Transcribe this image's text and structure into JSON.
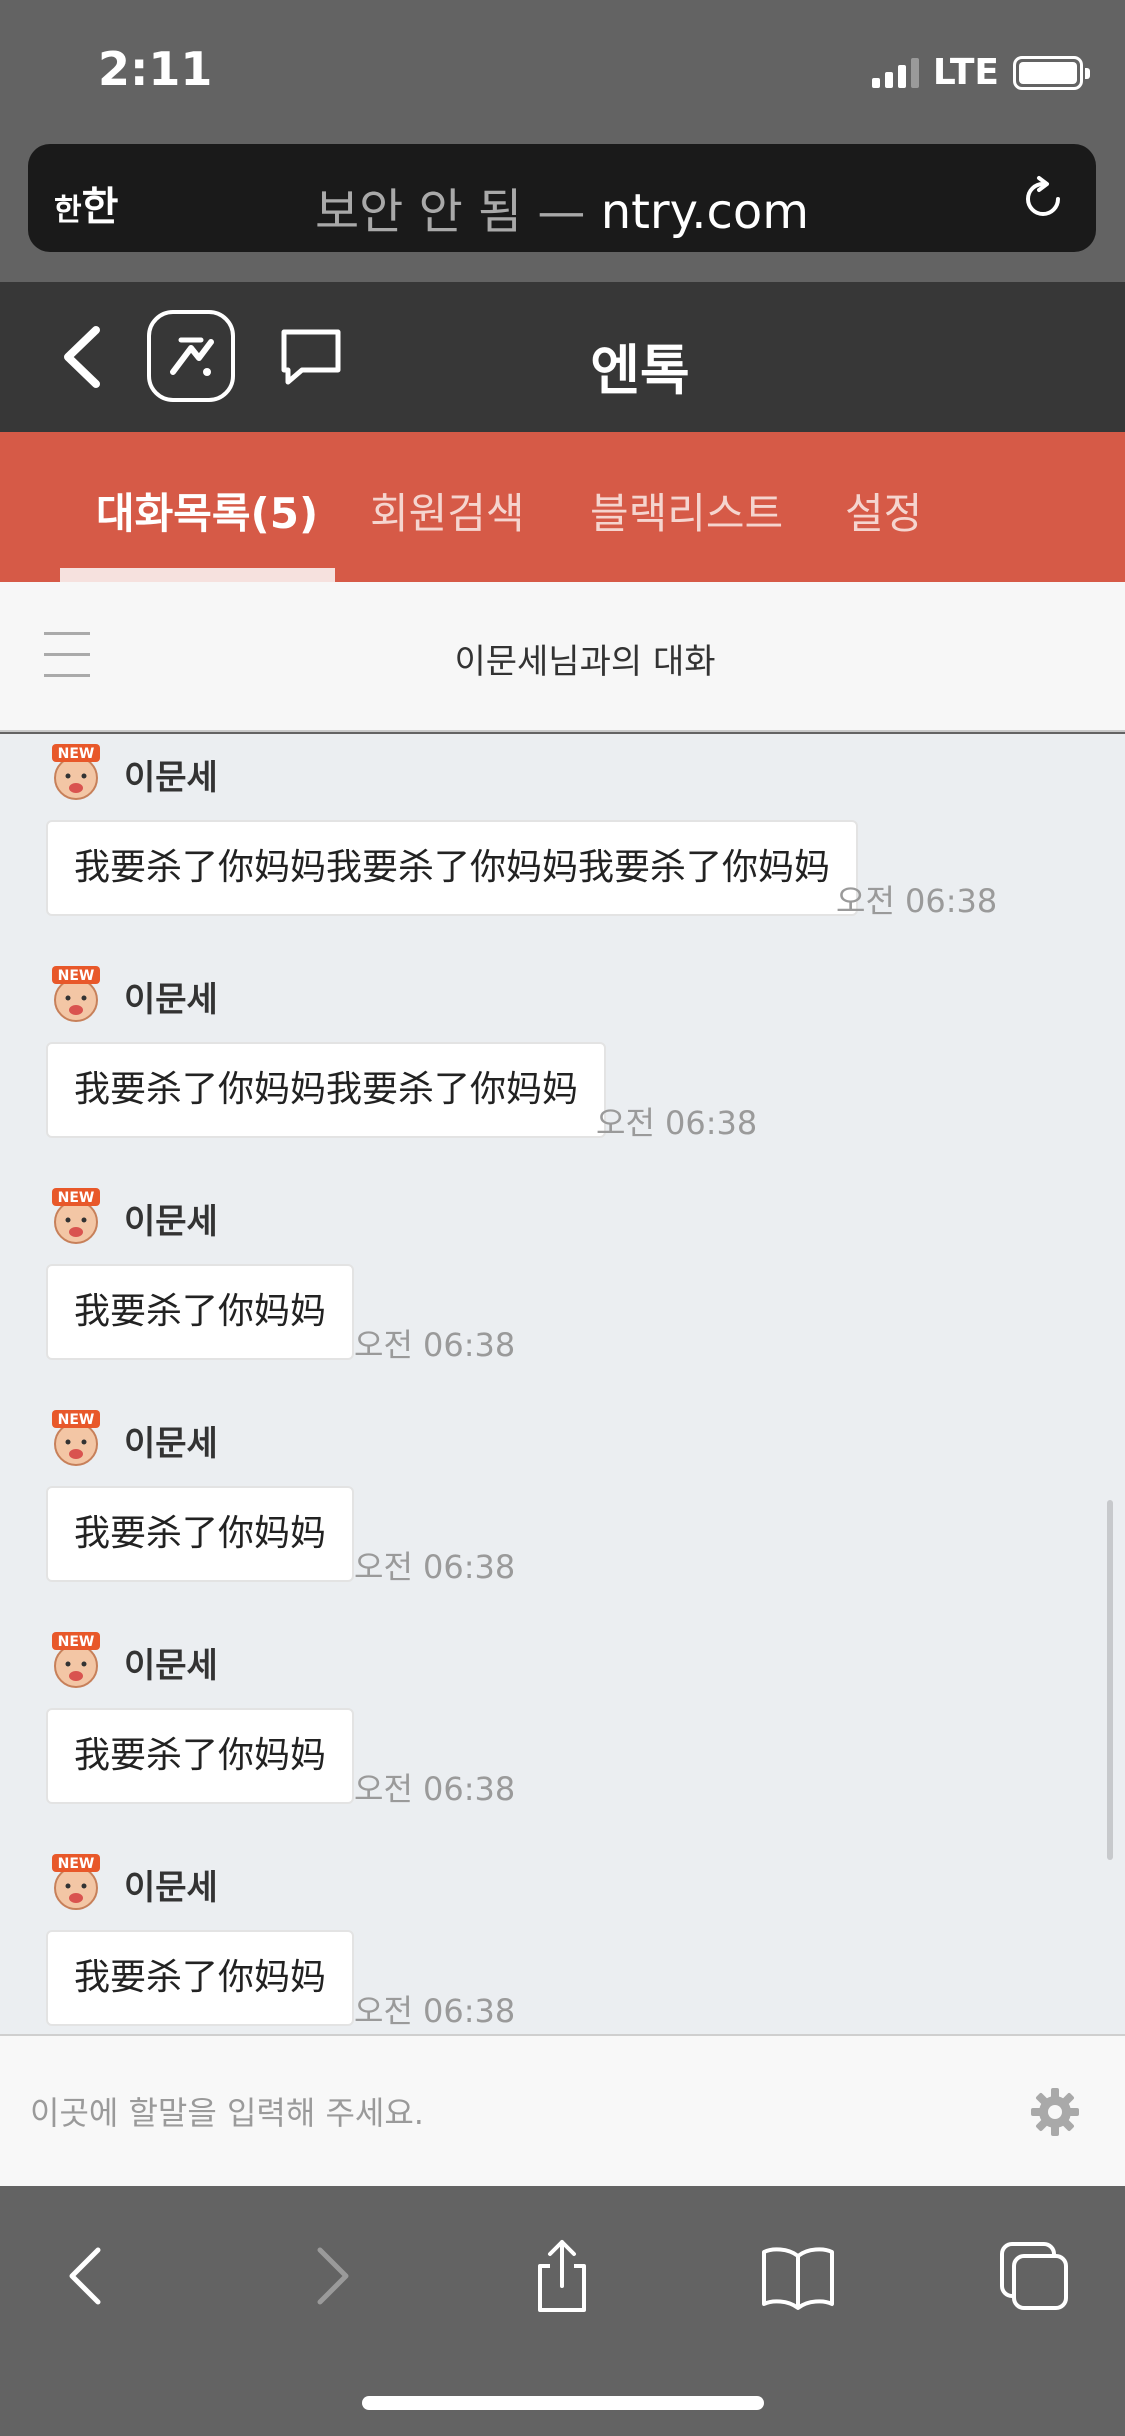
{
  "status_bar": {
    "time": "2:11",
    "network": "LTE"
  },
  "url_bar": {
    "text_size_label": "한",
    "text_size_label_large": "한",
    "security": "보안 안 됨",
    "separator": "—",
    "domain": "ntry.com"
  },
  "app": {
    "title": "엔톡"
  },
  "tabs": [
    {
      "label": "대화목록(5)",
      "active": true
    },
    {
      "label": "회원검색",
      "active": false
    },
    {
      "label": "블랙리스트",
      "active": false
    },
    {
      "label": "설정",
      "active": false
    }
  ],
  "conversation": {
    "title": "이문세님과의 대화"
  },
  "messages": [
    {
      "sender": "이문세",
      "text": "我要杀了你妈妈我要杀了你妈妈我要杀了你妈妈",
      "time": "오전 06:38"
    },
    {
      "sender": "이문세",
      "text": "我要杀了你妈妈我要杀了你妈妈",
      "time": "오전 06:38"
    },
    {
      "sender": "이문세",
      "text": "我要杀了你妈妈",
      "time": "오전 06:38"
    },
    {
      "sender": "이문세",
      "text": "我要杀了你妈妈",
      "time": "오전 06:38"
    },
    {
      "sender": "이문세",
      "text": "我要杀了你妈妈",
      "time": "오전 06:38"
    },
    {
      "sender": "이문세",
      "text": "我要杀了你妈妈",
      "time": "오전 06:38"
    }
  ],
  "input": {
    "placeholder": "이곳에 할말을 입력해 주세요."
  },
  "avatar_badge": "NEW",
  "colors": {
    "accent": "#d65a47",
    "header": "#373737",
    "chat_bg": "#ebeef1"
  }
}
